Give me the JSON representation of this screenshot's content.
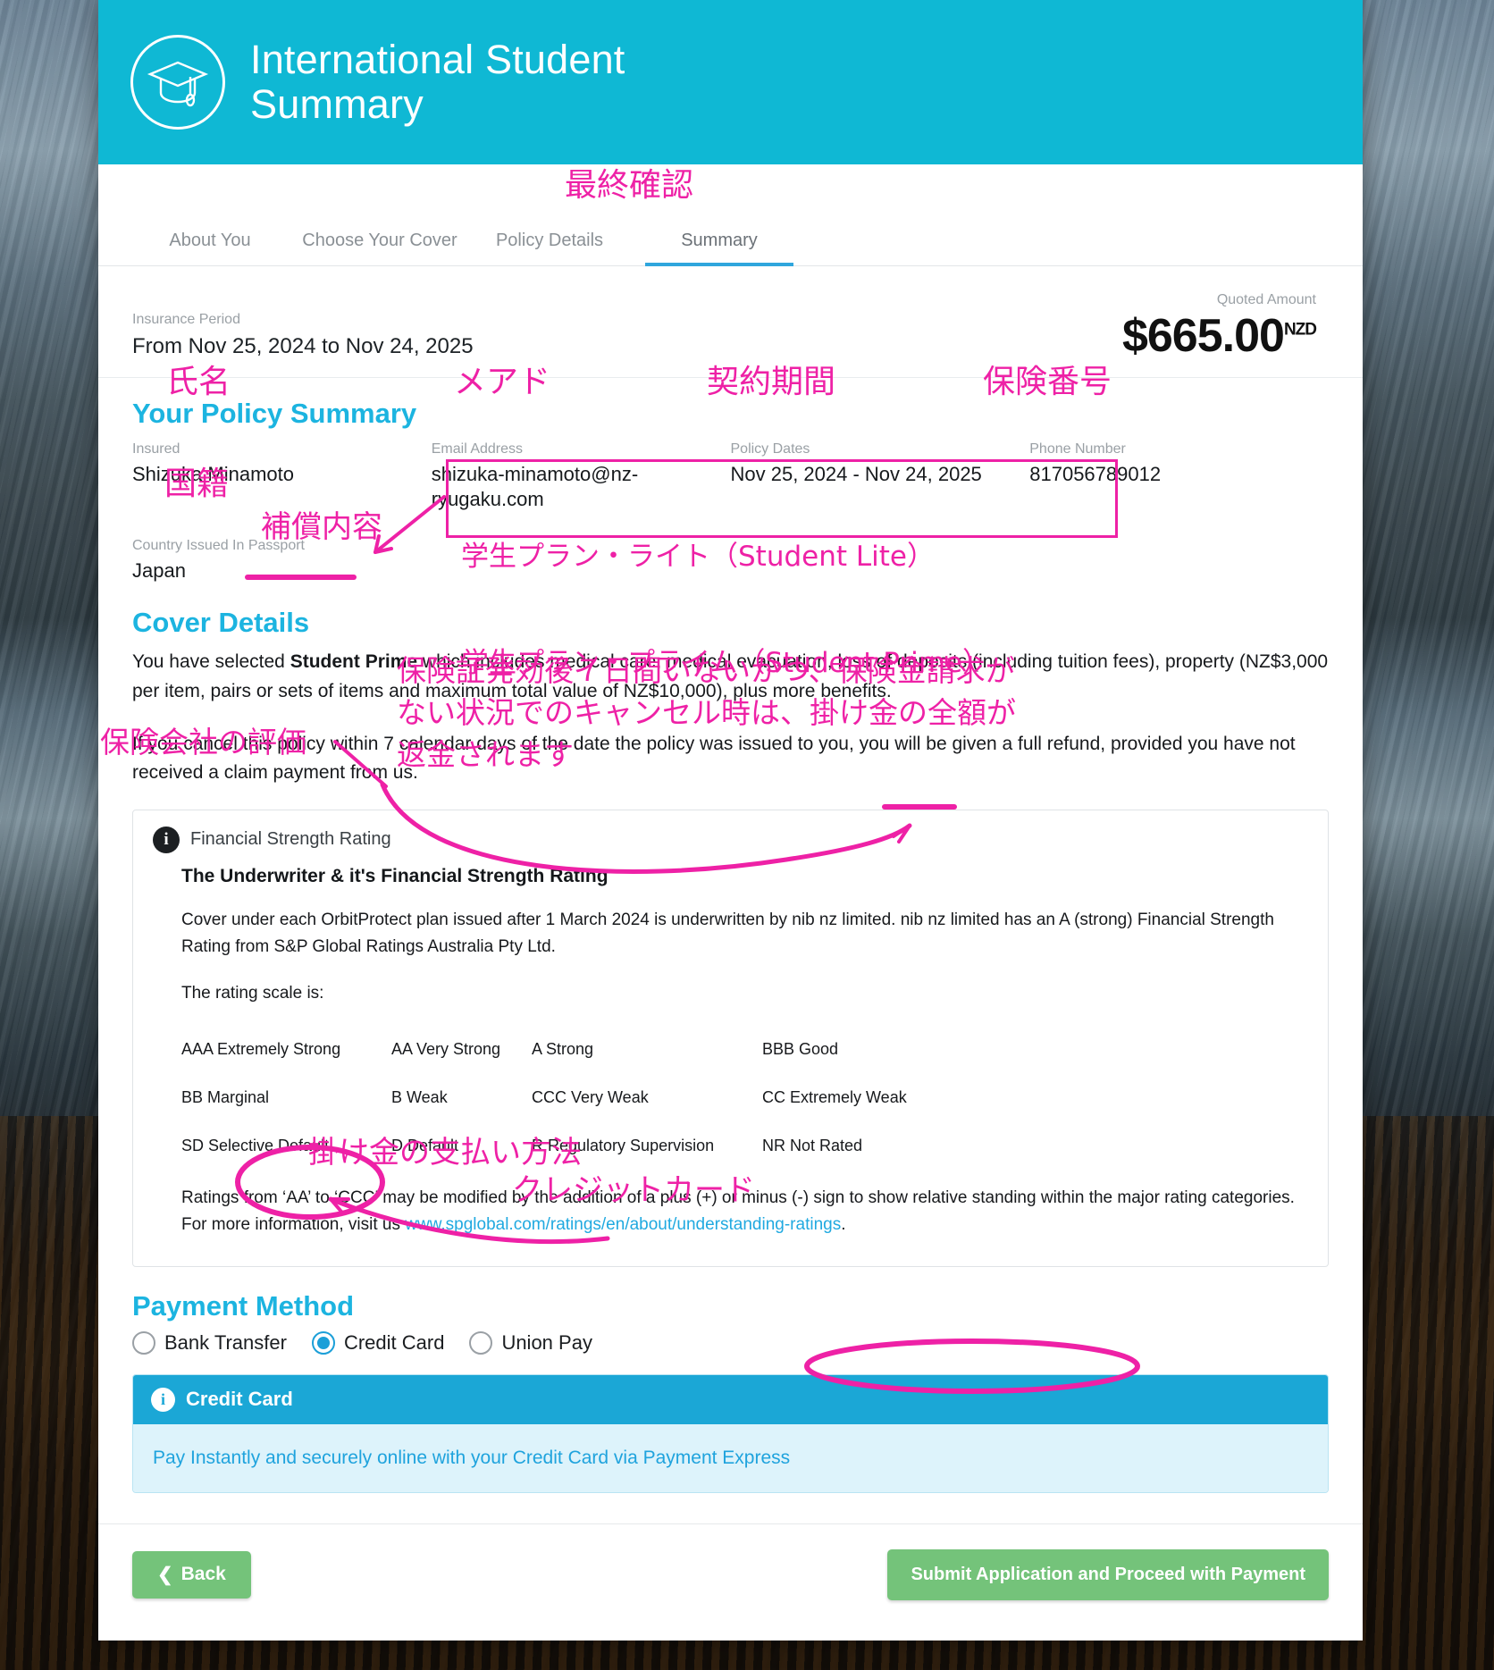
{
  "header": {
    "title": "International Student\nSummary",
    "icon": "graduation-cap-icon",
    "bg_color": "#0fb8d4"
  },
  "tabs": [
    {
      "label": "About You",
      "active": false
    },
    {
      "label": "Choose Your Cover",
      "active": false
    },
    {
      "label": "Policy Details",
      "active": false
    },
    {
      "label": "Summary",
      "active": true
    }
  ],
  "insurance_period": {
    "label": "Insurance Period",
    "value": "From Nov 25, 2024 to Nov 24, 2025"
  },
  "quote": {
    "label": "Quoted Amount",
    "amount": "$665.00",
    "currency": "NZD"
  },
  "policy_summary": {
    "title": "Your Policy Summary",
    "fields": [
      {
        "label": "Insured",
        "value": "Shizuka Minamoto"
      },
      {
        "label": "Email Address",
        "value": "shizuka-minamoto@nz-ryugaku.com"
      },
      {
        "label": "Policy Dates",
        "value": "Nov 25, 2024 - Nov 24, 2025"
      },
      {
        "label": "Phone Number",
        "value": "817056789012"
      }
    ],
    "country_label": "Country Issued In Passport",
    "country_value": "Japan"
  },
  "cover_details": {
    "title": "Cover Details",
    "selected_prefix": "You have selected ",
    "selected_plan": "Student Prime",
    "selected_suffix": " which includes medical care, medical evacuation, loss of deposits (including tuition fees), property (NZ$3,000 per item, pairs or sets of items and maximum total value of NZ$10,000), plus more benefits.",
    "cancel_text": "If you cancel this policy within 7 calendar days of the date the policy was issued to you, you will be given a full refund, provided you have not received a claim payment from us."
  },
  "financial_strength": {
    "panel_label": "Financial Strength Rating",
    "panel_icon": "info-icon",
    "subtitle": "The Underwriter & it's Financial Strength Rating",
    "paragraph": "Cover under each OrbitProtect plan issued after 1 March 2024 is underwritten by nib nz limited. nib nz limited has an A (strong) Financial Strength Rating from S&P Global Ratings Australia Pty Ltd.",
    "scale_intro": "The rating scale is:",
    "scale_rows": [
      [
        "AAA Extremely Strong",
        "AA Very Strong",
        "A Strong",
        "BBB Good"
      ],
      [
        "BB Marginal",
        "B Weak",
        "CCC Very Weak",
        "CC Extremely Weak"
      ],
      [
        "SD Selective Default",
        "D Default",
        "R Regulatory Supervision",
        "NR Not Rated"
      ]
    ],
    "footnote_before": "Ratings from ‘AA’ to ‘CCC’ may be modified by the addition of a plus (+) or minus (-) sign to show relative standing within the major rating categories. For more information, visit us ",
    "footnote_link": "www.spglobal.com/ratings/en/about/understanding-ratings",
    "footnote_after": "."
  },
  "payment": {
    "title": "Payment Method",
    "options": [
      {
        "label": "Bank Transfer",
        "selected": false
      },
      {
        "label": "Credit Card",
        "selected": true
      },
      {
        "label": "Union Pay",
        "selected": false
      }
    ],
    "callout_title": "Credit Card",
    "callout_icon": "info-icon",
    "callout_body": "Pay Instantly and securely online with your Credit Card via Payment Express"
  },
  "footer": {
    "back_label": "Back",
    "back_icon": "chevron-left-icon",
    "submit_label": "Submit Application and Proceed with Payment"
  },
  "annotations": {
    "color": "#ee21a6",
    "final_check": "最終確認",
    "name": "氏名",
    "email": "メアド",
    "policy_dates": "契約期間",
    "phone": "保険番号",
    "country": "国籍",
    "cover": "補償内容",
    "plan_box_line1": "学生プラン・ライト（Student Lite）",
    "plan_box_line2": "学生プラン・プライム（Student Prime）",
    "refund_note": "保険証発効後７日間いないかつ、保険金請求が\nない状況でのキャンセル時は、掛け金の全額が\n返金されます",
    "insurer_rating": "保険会社の評価",
    "payment_method": "掛け金の支払い方法",
    "credit_card": "クレジットカード"
  }
}
